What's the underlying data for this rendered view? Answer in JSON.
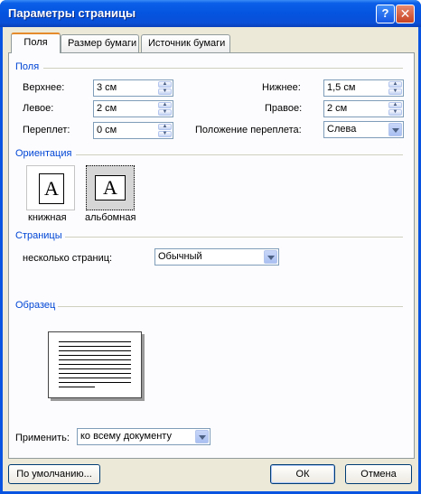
{
  "window": {
    "title": "Параметры страницы"
  },
  "tabs": [
    {
      "label": "Поля"
    },
    {
      "label": "Размер бумаги"
    },
    {
      "label": "Источник бумаги"
    }
  ],
  "margins": {
    "section_label": "Поля",
    "top": {
      "label": "Верхнее:",
      "value": "3 см"
    },
    "bottom": {
      "label": "Нижнее:",
      "value": "1,5 см"
    },
    "left": {
      "label": "Левое:",
      "value": "2 см"
    },
    "right": {
      "label": "Правое:",
      "value": "2 см"
    },
    "gutter": {
      "label": "Переплет:",
      "value": "0 см"
    },
    "gutter_position": {
      "label": "Положение переплета:",
      "value": "Слева"
    }
  },
  "orientation": {
    "section_label": "Ориентация",
    "portrait": {
      "label": "книжная",
      "glyph": "A"
    },
    "landscape": {
      "label": "альбомная",
      "glyph": "A"
    }
  },
  "pages": {
    "section_label": "Страницы",
    "multiple_label": "несколько страниц:",
    "multiple_value": "Обычный"
  },
  "preview": {
    "section_label": "Образец"
  },
  "apply": {
    "label": "Применить:",
    "value": "ко всему документу"
  },
  "buttons": {
    "default": "По умолчанию...",
    "ok": "ОК",
    "cancel": "Отмена"
  },
  "title_buttons": {
    "help": "?",
    "close": "✕"
  }
}
